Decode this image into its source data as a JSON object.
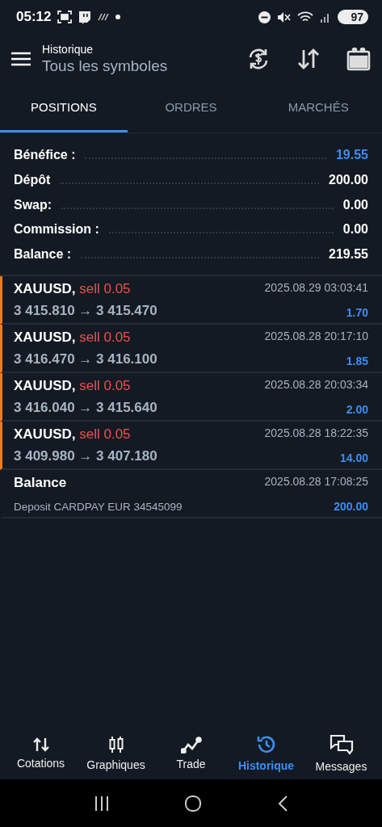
{
  "status_bar": {
    "time": "05:12",
    "battery": "97"
  },
  "header": {
    "title": "Historique",
    "subtitle": "Tous les symboles"
  },
  "tabs": [
    {
      "label": "POSITIONS",
      "selected": true
    },
    {
      "label": "ORDRES",
      "selected": false
    },
    {
      "label": "MARCHÉS",
      "selected": false
    }
  ],
  "summary": [
    {
      "label": "Bénéfice :",
      "value": "19.55",
      "kind": "profit"
    },
    {
      "label": "Dépôt",
      "value": "200.00",
      "kind": "plain"
    },
    {
      "label": "Swap:",
      "value": "0.00",
      "kind": "plain"
    },
    {
      "label": "Commission :",
      "value": "0.00",
      "kind": "plain"
    },
    {
      "label": "Balance :",
      "value": "219.55",
      "kind": "plain"
    }
  ],
  "deals": [
    {
      "kind": "trade",
      "symbol": "XAUUSD,",
      "side": "sell 0.05",
      "detail": "3 415.810 → 3 415.470",
      "time": "2025.08.29 03:03:41",
      "profit": "1.70"
    },
    {
      "kind": "trade",
      "symbol": "XAUUSD,",
      "side": "sell 0.05",
      "detail": "3 416.470 → 3 416.100",
      "time": "2025.08.28 20:17:10",
      "profit": "1.85"
    },
    {
      "kind": "trade",
      "symbol": "XAUUSD,",
      "side": "sell 0.05",
      "detail": "3 416.040 → 3 415.640",
      "time": "2025.08.28 20:03:34",
      "profit": "2.00"
    },
    {
      "kind": "trade",
      "symbol": "XAUUSD,",
      "side": "sell 0.05",
      "detail": "3 409.980 → 3 407.180",
      "time": "2025.08.28 18:22:35",
      "profit": "14.00"
    },
    {
      "kind": "balance",
      "symbol": "Balance",
      "detail": "Deposit CARDPAY EUR 34545099",
      "time": "2025.08.28 17:08:25",
      "profit": "200.00"
    }
  ],
  "nav": [
    {
      "label": "Cotations",
      "selected": false
    },
    {
      "label": "Graphiques",
      "selected": false
    },
    {
      "label": "Trade",
      "selected": false
    },
    {
      "label": "Historique",
      "selected": true
    },
    {
      "label": "Messages",
      "selected": false
    }
  ]
}
